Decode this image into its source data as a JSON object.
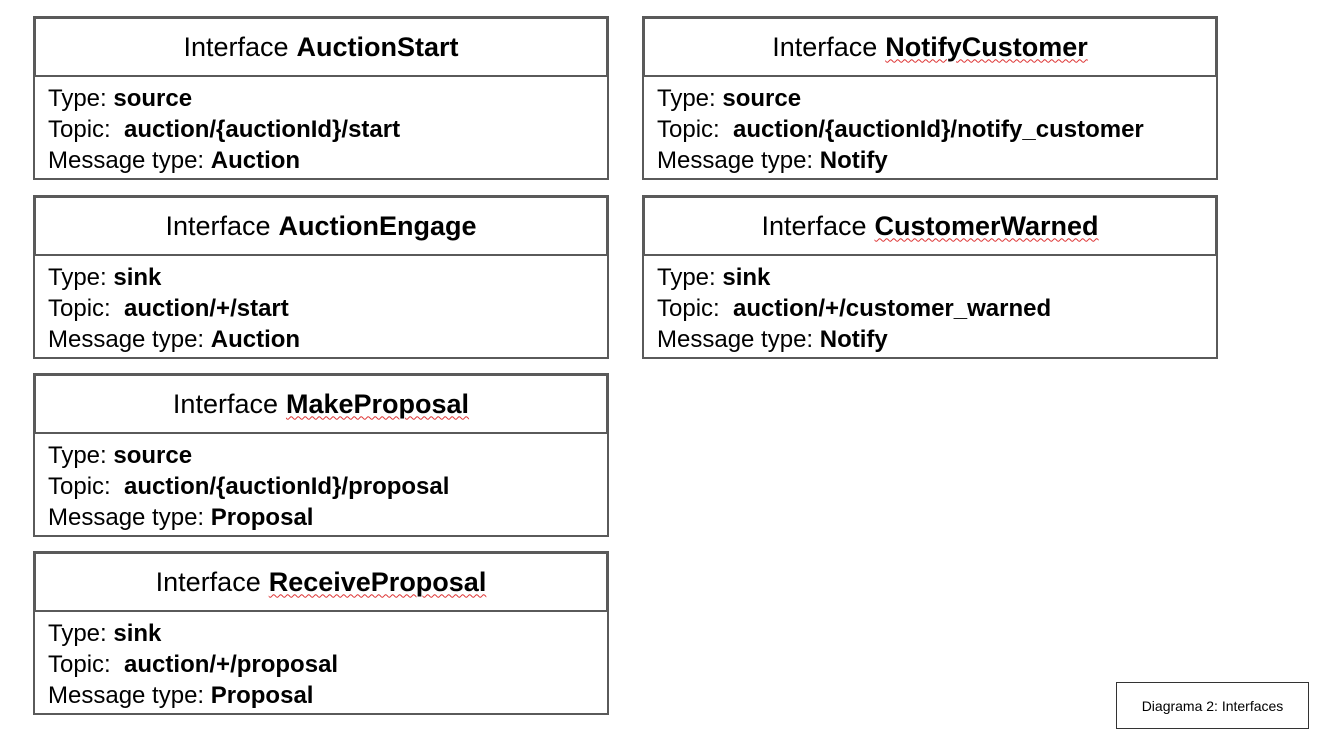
{
  "cards": [
    {
      "keyword": "Interface",
      "name": "AuctionStart",
      "type_label": "Type:",
      "type_value": "source",
      "topic_label": "Topic:",
      "topic_value": "auction/{auctionId}/start",
      "message_label": "Message type:",
      "message_value": "Auction"
    },
    {
      "keyword": "Interface",
      "name": "NotifyCustomer",
      "type_label": "Type:",
      "type_value": "source",
      "topic_label": "Topic:",
      "topic_value": "auction/{auctionId}/notify_customer",
      "message_label": "Message type:",
      "message_value": "Notify"
    },
    {
      "keyword": "Interface",
      "name": "AuctionEngage",
      "type_label": "Type:",
      "type_value": "sink",
      "topic_label": "Topic:",
      "topic_value": "auction/+/start",
      "message_label": "Message type:",
      "message_value": "Auction"
    },
    {
      "keyword": "Interface",
      "name": "CustomerWarned",
      "type_label": "Type:",
      "type_value": "sink",
      "topic_label": "Topic:",
      "topic_value": "auction/+/customer_warned",
      "message_label": "Message type:",
      "message_value": "Notify"
    },
    {
      "keyword": "Interface",
      "name": "MakeProposal",
      "type_label": "Type:",
      "type_value": "source",
      "topic_label": "Topic:",
      "topic_value": "auction/{auctionId}/proposal",
      "message_label": "Message type:",
      "message_value": "Proposal"
    },
    {
      "keyword": "Interface",
      "name": "ReceiveProposal",
      "type_label": "Type:",
      "type_value": "sink",
      "topic_label": "Topic:",
      "topic_value": "auction/+/proposal",
      "message_label": "Message type:",
      "message_value": "Proposal"
    }
  ],
  "caption": "Diagrama 2: Interfaces",
  "colors": {
    "border": "#5a5a5a",
    "spellcheck_underline": "#d33"
  }
}
